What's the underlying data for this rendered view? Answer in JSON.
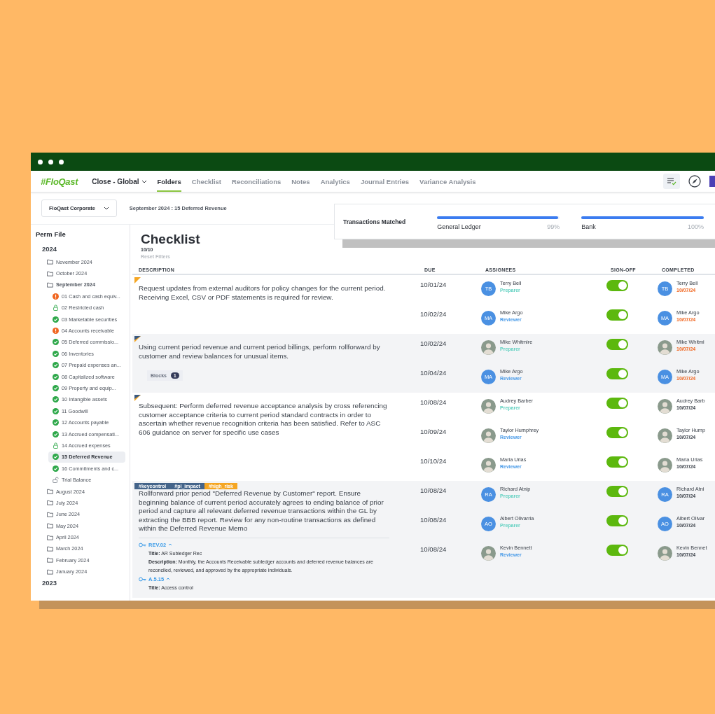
{
  "nav": {
    "logo": "#FloQast",
    "workspace": "Close - Global",
    "tabs": [
      {
        "label": "Folders",
        "selected": true
      },
      {
        "label": "Checklist",
        "selected": false
      },
      {
        "label": "Reconciliations",
        "selected": false
      },
      {
        "label": "Notes",
        "selected": false
      },
      {
        "label": "Analytics",
        "selected": false
      },
      {
        "label": "Journal Entries",
        "selected": false
      },
      {
        "label": "Variance Analysis",
        "selected": false
      }
    ]
  },
  "subheader": {
    "entity": "FloQast Corporate",
    "breadcrumb": "September 2024 : 15 Deferred Revenue"
  },
  "matched": {
    "title": "Transactions Matched",
    "meters": [
      {
        "label": "General Ledger",
        "level": 0.99,
        "reading": "99%"
      },
      {
        "label": "Bank",
        "level": 1.0,
        "reading": "100%"
      }
    ]
  },
  "sidebar": {
    "title": "Perm File",
    "years": [
      {
        "label": "2024",
        "children": [
          {
            "label": "November 2024",
            "expanded": false
          },
          {
            "label": "October 2024",
            "expanded": false
          },
          {
            "label": "September 2024",
            "expanded": true,
            "children": [
              {
                "label": "01 Cash and cash equiv...",
                "kind": "warning",
                "selected": false
              },
              {
                "label": "02 Restricted cash",
                "kind": "locked",
                "selected": false
              },
              {
                "label": "03 Marketable securities",
                "kind": "done",
                "selected": false
              },
              {
                "label": "04 Accounts receivable",
                "kind": "warning",
                "selected": false
              },
              {
                "label": "05 Deferred commissio...",
                "kind": "done",
                "selected": false
              },
              {
                "label": "06 Inventories",
                "kind": "done",
                "selected": false
              },
              {
                "label": "07 Prepaid expenses an...",
                "kind": "done",
                "selected": false
              },
              {
                "label": "08 Capitalized software",
                "kind": "done",
                "selected": false
              },
              {
                "label": "09 Property and equip...",
                "kind": "done",
                "selected": false
              },
              {
                "label": "10 Intangible assets",
                "kind": "done",
                "selected": false
              },
              {
                "label": "11 Goodwill",
                "kind": "done",
                "selected": false
              },
              {
                "label": "12 Accounts payable",
                "kind": "done",
                "selected": false
              },
              {
                "label": "13 Accrued compensati...",
                "kind": "done",
                "selected": false
              },
              {
                "label": "14 Accrued expenses",
                "kind": "locked",
                "selected": false
              },
              {
                "label": "15 Deferred Revenue",
                "kind": "done",
                "selected": true
              },
              {
                "label": "16 Commitments and c...",
                "kind": "done",
                "selected": false
              },
              {
                "label": "Trial Balance",
                "kind": "unlocked",
                "selected": false
              }
            ]
          },
          {
            "label": "August 2024",
            "expanded": false
          },
          {
            "label": "July 2024",
            "expanded": false
          },
          {
            "label": "June 2024",
            "expanded": false
          },
          {
            "label": "May 2024",
            "expanded": false
          },
          {
            "label": "April 2024",
            "expanded": false
          },
          {
            "label": "March 2024",
            "expanded": false
          },
          {
            "label": "February 2024",
            "expanded": false
          },
          {
            "label": "January 2024",
            "expanded": false
          }
        ]
      },
      {
        "label": "2023"
      }
    ]
  },
  "checklist": {
    "title": "Checklist",
    "count": "10/10",
    "reset": "Reset Filters",
    "columns": [
      "DESCRIPTION",
      "DUE",
      "ASSIGNEES",
      "SIGN-OFF",
      "COMPLETED"
    ],
    "groups": [
      {
        "kind": "single",
        "description": "Request updates from external auditors for policy changes for the current period. Receiving Excel, CSV or PDF statements is required for review.",
        "rows": [
          {
            "due": "10/01/24",
            "assignee": {
              "name": "Terry Bell",
              "initials": "TB",
              "role": "Preparer",
              "kind": "preparer"
            },
            "signed": true,
            "completed": {
              "name": "Terry Bell",
              "initials": "TB",
              "date": "10/07/24",
              "late": true
            }
          },
          {
            "due": "10/02/24",
            "assignee": {
              "name": "Mike Argo",
              "initials": "MA",
              "role": "Reviewer",
              "kind": "reviewer"
            },
            "signed": true,
            "completed": {
              "name": "Mike Argo",
              "initials": "MA",
              "date": "10/07/24",
              "late": true
            }
          }
        ]
      },
      {
        "kind": "split",
        "description": "Using current period revenue and current period billings, perform rollforward by customer and review balances for unusual items.",
        "blocks": {
          "label": "Blocks",
          "count": "1"
        },
        "rows": [
          {
            "due": "10/02/24",
            "assignee": {
              "name": "Mike Whitmire",
              "role": "Preparer",
              "kind": "preparer"
            },
            "signed": true,
            "completed": {
              "name": "Mike Whitmi",
              "date": "10/07/24",
              "late": true
            }
          },
          {
            "due": "10/04/24",
            "assignee": {
              "name": "Mike Argo",
              "initials": "MA",
              "role": "Reviewer",
              "kind": "reviewer"
            },
            "signed": true,
            "completed": {
              "name": "Mike Argo",
              "initials": "MA",
              "date": "10/07/24",
              "late": true
            }
          }
        ]
      },
      {
        "kind": "split",
        "description": "Subsequent: Perform deferred revenue acceptance analysis by cross referencing customer acceptance criteria to current period standard contracts in order to ascertain whether revenue recognition criteria has been satisfied. Refer to ASC 606 guidance on server for specific use cases",
        "rows": [
          {
            "due": "10/08/24",
            "assignee": {
              "name": "Audrey Barber",
              "role": "Preparer",
              "kind": "preparer"
            },
            "signed": true,
            "completed": {
              "name": "Audrey Barb",
              "date": "10/07/24",
              "late": false
            }
          },
          {
            "due": "10/09/24",
            "assignee": {
              "name": "Taylor Humphrey",
              "role": "Reviewer",
              "kind": "reviewer"
            },
            "signed": true,
            "completed": {
              "name": "Taylor Hump",
              "date": "10/07/24",
              "late": false
            }
          },
          {
            "due": "10/10/24",
            "assignee": {
              "name": "Maria Urias",
              "role": "Reviewer",
              "kind": "reviewer"
            },
            "signed": true,
            "completed": {
              "name": "Maria Urias",
              "date": "10/07/24",
              "late": false
            }
          }
        ]
      },
      {
        "kind": "tagged",
        "tags": [
          {
            "label": "#keycontrol",
            "color": "#44648a"
          },
          {
            "label": "#pl_impact",
            "color": "#44648a"
          },
          {
            "label": "#high_risk",
            "color": "#f5a623"
          }
        ],
        "description": "Rollforward prior period \"Deferred Revenue by Customer\" report. Ensure beginning balance of current period accurately agrees to ending balance of prior period and capture all relevant deferred revenue transactions within the GL by extracting the BBB report. Review for any non-routine transactions as defined within the Deferred Revenue Memo",
        "controls": [
          {
            "code": "REV.02",
            "expanded": true,
            "lines": [
              "**Title:** AR Subledger Rec",
              "**Description:** Monthly, the Accounts Receivable subledger accounts and deferred revenue balances are reconciled, reviewed, and approved by the appropriate individuals."
            ]
          },
          {
            "code": "A.5.15",
            "expanded": true,
            "lines": [
              "**Title:** Access control"
            ]
          }
        ],
        "rows": [
          {
            "due": "10/08/24",
            "assignee": {
              "name": "Richard Atnip",
              "initials": "RA",
              "role": "Preparer",
              "kind": "preparer"
            },
            "signed": true,
            "completed": {
              "name": "Richard Atni",
              "initials": "RA",
              "date": "10/07/24",
              "late": false
            }
          },
          {
            "due": "10/08/24",
            "assignee": {
              "name": "Albert Olivarria",
              "initials": "AO",
              "role": "Preparer",
              "kind": "preparer"
            },
            "signed": true,
            "completed": {
              "name": "Albert Olivar",
              "initials": "AO",
              "date": "10/07/24",
              "late": false
            }
          },
          {
            "due": "10/08/24",
            "assignee": {
              "name": "Kevin Bennett",
              "role": "Reviewer",
              "kind": "reviewer"
            },
            "signed": true,
            "completed": {
              "name": "Kevin Bennet",
              "date": "10/07/24",
              "late": false
            }
          }
        ]
      }
    ]
  }
}
